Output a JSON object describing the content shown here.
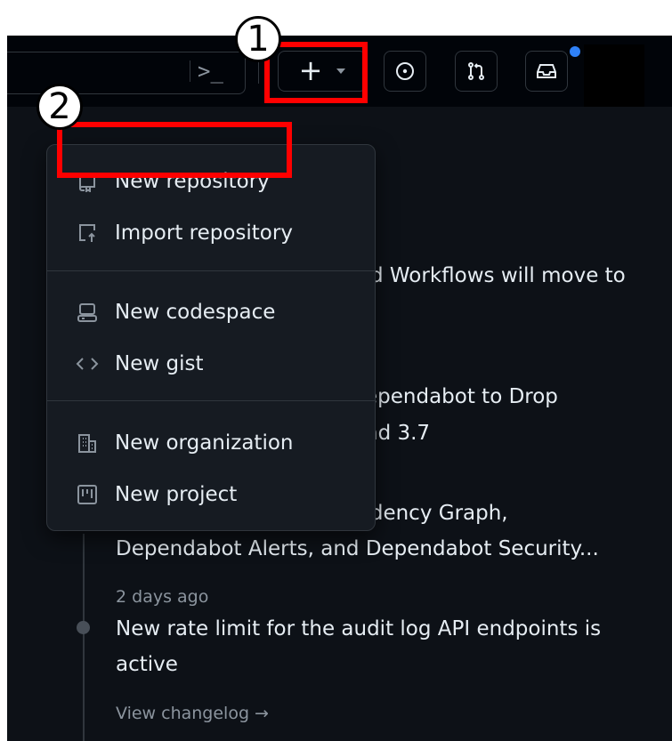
{
  "header": {
    "terminal_glyph": ">_",
    "create_plus": "+",
    "icons": [
      "command-palette-icon",
      "plus-icon",
      "issues-icon",
      "pull-requests-icon",
      "inbox-icon"
    ]
  },
  "annotations": {
    "callout_1": "1",
    "callout_2": "2"
  },
  "menu": {
    "items": [
      {
        "label": "New repository",
        "icon": "repo-icon"
      },
      {
        "label": "Import repository",
        "icon": "repo-push-icon"
      },
      {
        "label": "New codespace",
        "icon": "codespaces-icon"
      },
      {
        "label": "New gist",
        "icon": "code-icon"
      },
      {
        "label": "New organization",
        "icon": "organization-icon"
      },
      {
        "label": "New project",
        "icon": "project-icon"
      }
    ]
  },
  "feed": {
    "frag1": "d Workflows will move to",
    "frag2a": "ependabot to Drop",
    "frag2b": "nd 3.7",
    "item3_line1": "pnpm Support for Dependency Graph,",
    "item3_line2": "Dependabot Alerts, and Dependabot Security...",
    "item4_time": "2 days ago",
    "item4_line1": "New rate limit for the audit log API endpoints is",
    "item4_line2": "active",
    "view_changelog": "View changelog →"
  },
  "colors": {
    "background": "#0d1117",
    "menu": "#161b22",
    "border": "#30363d",
    "accent_blue": "#2f81f7",
    "highlight_red": "#ff0000"
  }
}
